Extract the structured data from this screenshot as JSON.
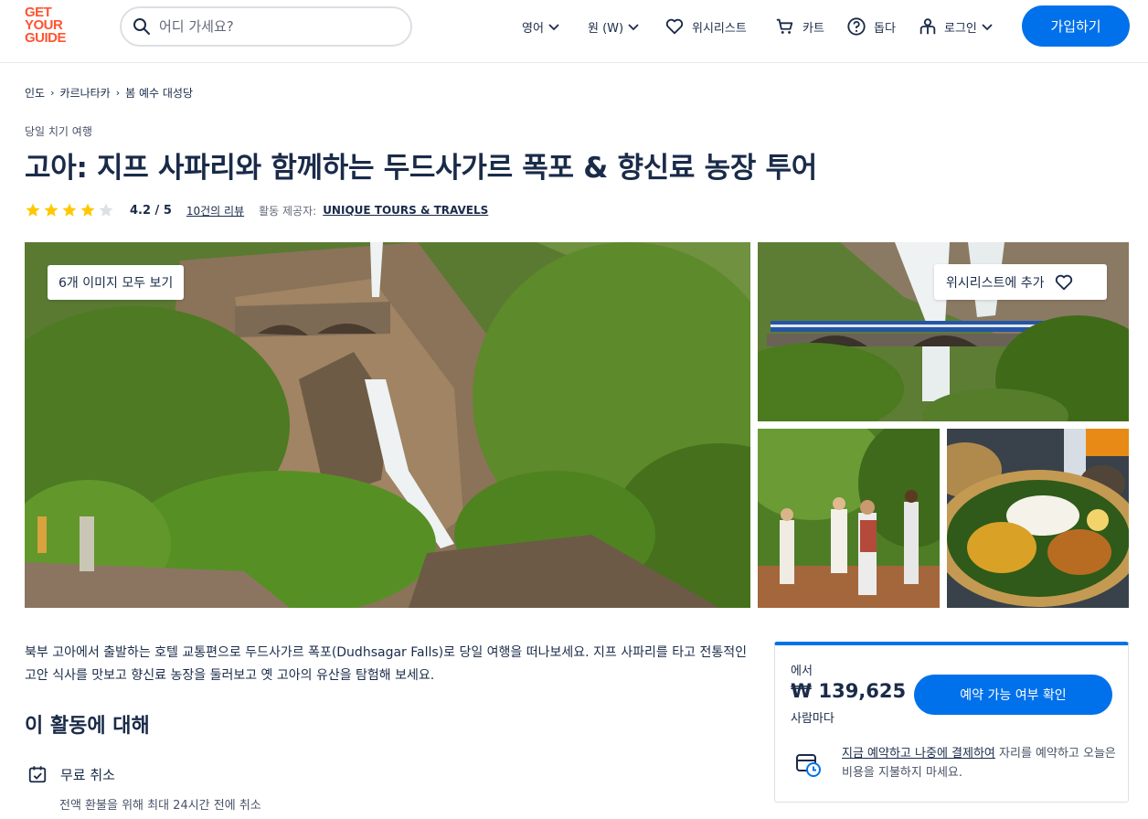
{
  "header": {
    "logo_lines": [
      "GET",
      "YOUR",
      "GUIDE"
    ],
    "search_placeholder": "어디 가세요?",
    "language": "영어",
    "currency": "원 (W)",
    "wishlist": "위시리스트",
    "cart": "카트",
    "help": "돕다",
    "login": "로그인",
    "signup": "가입하기"
  },
  "breadcrumb": [
    "인도",
    "카르나타카",
    "봄 예수 대성당"
  ],
  "category": "당일 치기 여행",
  "title": "고아: 지프 사파리와 함께하는 두드사가르 폭포 & 향신료 농장 투어",
  "rating": {
    "value": "4.2 / 5",
    "stars_filled": 4,
    "stars_total": 5,
    "reviews": "10건의 리뷰",
    "provider_label": "활동 제공자:",
    "provider": "UNIQUE TOURS & TRAVELS"
  },
  "gallery": {
    "view_all": "6개 이미지 모두 보기",
    "wishlist_add": "위시리스트에 추가"
  },
  "description": "북부 고아에서 출발하는 호텔 교통편으로 두드사가르 폭포(Dudhsagar Falls)로 당일 여행을 떠나보세요. 지프 사파리를 타고 전통적인 고안 식사를 맛보고 향신료 농장을 둘러보고 옛 고아의 유산을 탐험해 보세요.",
  "about": {
    "heading": "이 활동에 대해",
    "feature_title": "무료 취소",
    "feature_sub": "전액 환불을 위해 최대 24시간 전에 취소"
  },
  "booking": {
    "from": "에서",
    "price": "₩ 139,625",
    "per": "사람마다",
    "check_button": "예약 가능 여부 확인",
    "reserve_link": "지금 예약하고 나중에 결제하여",
    "reserve_text": " 자리를 예약하고 오늘은 비용을 지불하지 마세요."
  },
  "colors": {
    "brand": "#ff5533",
    "primary": "#0071eb",
    "star": "#ffc800",
    "text": "#1a2b49"
  }
}
